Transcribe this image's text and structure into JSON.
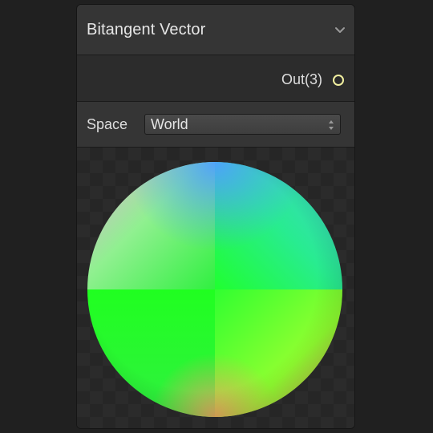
{
  "node": {
    "title": "Bitangent Vector",
    "collapse_icon": "chevron-down-icon"
  },
  "ports": {
    "output_label": "Out(3)",
    "output_dot_color": "#f2f0a0"
  },
  "settings": {
    "space_label": "Space",
    "space_value": "World",
    "dropdown_icon": "up-down-arrows-icon"
  },
  "preview": {
    "shape": "sphere",
    "colors": {
      "top": "#4fb3ff",
      "upper_left": "#b8e8b8",
      "upper_right": "#30e0c0",
      "middle": "#20ff30",
      "lower_right": "#a0ff30",
      "bottom": "#e6b060"
    }
  }
}
